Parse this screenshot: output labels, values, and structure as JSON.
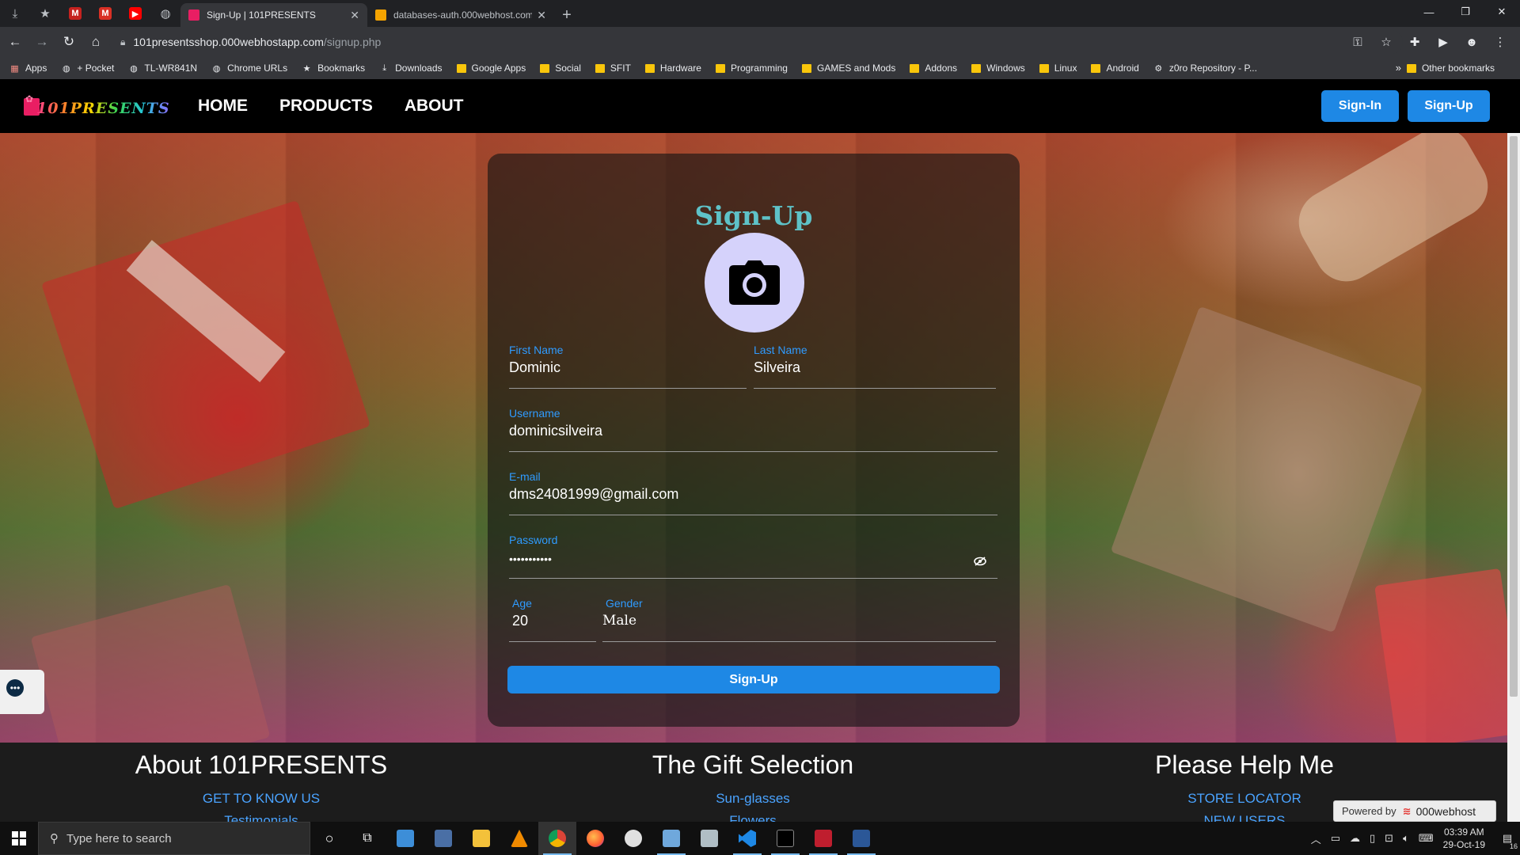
{
  "browser": {
    "pinned_tabs": [
      {
        "icon": "download-icon"
      },
      {
        "icon": "star-icon"
      },
      {
        "icon": "gmail-icon"
      },
      {
        "icon": "gmail-icon"
      },
      {
        "icon": "youtube-icon"
      },
      {
        "icon": "globe-icon"
      }
    ],
    "tabs": [
      {
        "title": "Sign-Up | 101PRESENTS",
        "active": true
      },
      {
        "title": "databases-auth.000webhost.com",
        "active": false
      }
    ],
    "url_host": "101presentsshop.000webhostapp.com",
    "url_path": "/signup.php",
    "bookmarks": [
      {
        "label": "Apps",
        "icon": "apps-grid-icon"
      },
      {
        "label": "+ Pocket",
        "icon": "globe-icon"
      },
      {
        "label": "TL-WR841N",
        "icon": "globe-icon"
      },
      {
        "label": "Chrome URLs",
        "icon": "globe-icon"
      },
      {
        "label": "Bookmarks",
        "icon": "star-icon"
      },
      {
        "label": "Downloads",
        "icon": "download-icon"
      },
      {
        "label": "Google Apps",
        "icon": "folder-icon"
      },
      {
        "label": "Social",
        "icon": "folder-icon"
      },
      {
        "label": "SFIT",
        "icon": "folder-icon"
      },
      {
        "label": "Hardware",
        "icon": "folder-icon"
      },
      {
        "label": "Programming",
        "icon": "folder-icon"
      },
      {
        "label": "GAMES and Mods",
        "icon": "folder-icon"
      },
      {
        "label": "Addons",
        "icon": "folder-icon"
      },
      {
        "label": "Windows",
        "icon": "folder-icon"
      },
      {
        "label": "Linux",
        "icon": "folder-icon"
      },
      {
        "label": "Android",
        "icon": "folder-icon"
      },
      {
        "label": "z0ro Repository - P...",
        "icon": "gear-icon"
      }
    ],
    "more_bookmarks": "»",
    "other_bookmarks": "Other bookmarks"
  },
  "site": {
    "logo_text": "101PRESENTS",
    "nav": [
      "HOME",
      "PRODUCTS",
      "ABOUT"
    ],
    "signin_label": "Sign-In",
    "signup_label": "Sign-Up"
  },
  "form": {
    "title": "Sign-Up",
    "first_name_label": "First Name",
    "first_name_value": "Dominic",
    "last_name_label": "Last Name",
    "last_name_value": "Silveira",
    "username_label": "Username",
    "username_value": "dominicsilveira",
    "email_label": "E-mail",
    "email_value": "dms24081999@gmail.com",
    "password_label": "Password",
    "password_value": "•••••••••••",
    "age_label": "Age",
    "age_value": "20",
    "gender_label": "Gender",
    "gender_value": "Male",
    "submit_label": "Sign-Up"
  },
  "footer": {
    "col1_title": "About 101PRESENTS",
    "col1_links": [
      "GET TO KNOW US",
      "Testimonials"
    ],
    "col2_title": "The Gift Selection",
    "col2_links": [
      "Sun-glasses",
      "Flowers"
    ],
    "col3_title": "Please Help Me",
    "col3_links": [
      "STORE LOCATOR",
      "NEW USERS"
    ],
    "powered_label": "Powered by",
    "powered_brand": "000webhost"
  },
  "taskbar": {
    "search_placeholder": "Type here to search",
    "time": "03:39 AM",
    "date": "29-Oct-19",
    "notification_count": "16"
  },
  "colors": {
    "accent_blue": "#1e88e5",
    "title_teal": "#5ec2c8",
    "label_blue": "#2f9bff",
    "avatar_bg": "#d5d2fb"
  }
}
